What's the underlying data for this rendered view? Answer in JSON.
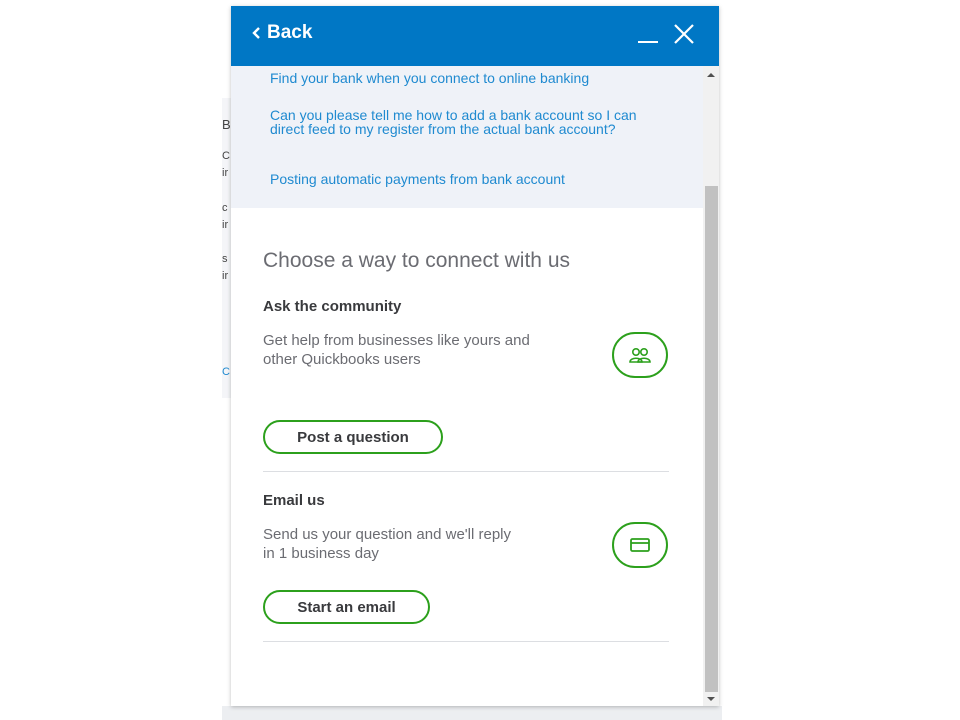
{
  "header": {
    "back_label": "Back"
  },
  "background_fragments": [
    "B",
    "C",
    "ir",
    "c",
    "ir",
    "s",
    "ir",
    "C"
  ],
  "related_links": [
    "Find your bank when you connect to online banking",
    "Can you please tell me how to add a bank account so I can direct feed to my register from the actual bank account?",
    "Posting automatic payments from bank account"
  ],
  "connect": {
    "title": "Choose a way to connect with us",
    "community": {
      "title": "Ask the community",
      "description": "Get help from businesses like yours and other Quickbooks users",
      "button_label": "Post a question",
      "icon": "community-icon"
    },
    "email": {
      "title": "Email us",
      "description": "Send us your question and we'll reply in 1 business day",
      "button_label": "Start an email",
      "icon": "envelope-icon"
    }
  },
  "colors": {
    "header_bg": "#0077c5",
    "link": "#1f8ad0",
    "accent_green": "#2ca01c",
    "links_bg": "#eff2f8"
  }
}
